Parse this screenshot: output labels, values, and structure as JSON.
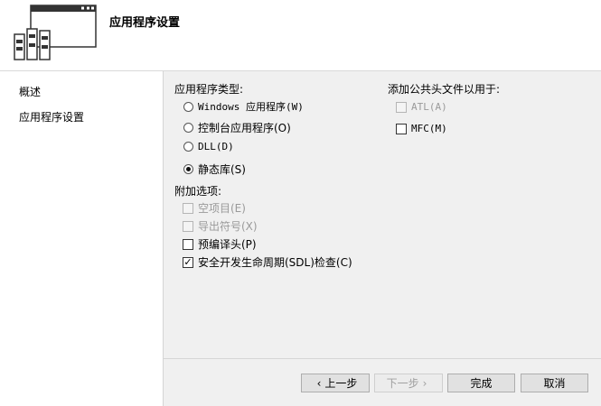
{
  "header": {
    "title": "应用程序设置"
  },
  "sidebar": {
    "items": [
      {
        "label": "概述"
      },
      {
        "label": "应用程序设置"
      }
    ]
  },
  "app_type": {
    "label": "应用程序类型:",
    "options": [
      {
        "label": "Windows 应用程序(W)",
        "checked": false
      },
      {
        "label": "控制台应用程序(O)",
        "checked": false
      },
      {
        "label": "DLL(D)",
        "checked": false
      },
      {
        "label": "静态库(S)",
        "checked": true
      }
    ]
  },
  "extra": {
    "label": "附加选项:",
    "options": [
      {
        "label": "空项目(E)",
        "checked": false,
        "disabled": true
      },
      {
        "label": "导出符号(X)",
        "checked": false,
        "disabled": true
      },
      {
        "label": "预编译头(P)",
        "checked": false,
        "disabled": false
      },
      {
        "label": "安全开发生命周期(SDL)检查(C)",
        "checked": true,
        "disabled": false
      }
    ]
  },
  "headers": {
    "label": "添加公共头文件以用于:",
    "options": [
      {
        "label": "ATL(A)",
        "checked": false,
        "disabled": true
      },
      {
        "label": "MFC(M)",
        "checked": false,
        "disabled": false
      }
    ]
  },
  "buttons": {
    "prev": "上一步",
    "next": "下一步",
    "finish": "完成",
    "cancel": "取消"
  },
  "icons": {
    "prev_arrow": "‹",
    "next_arrow": "›",
    "checkmark": "✓"
  }
}
